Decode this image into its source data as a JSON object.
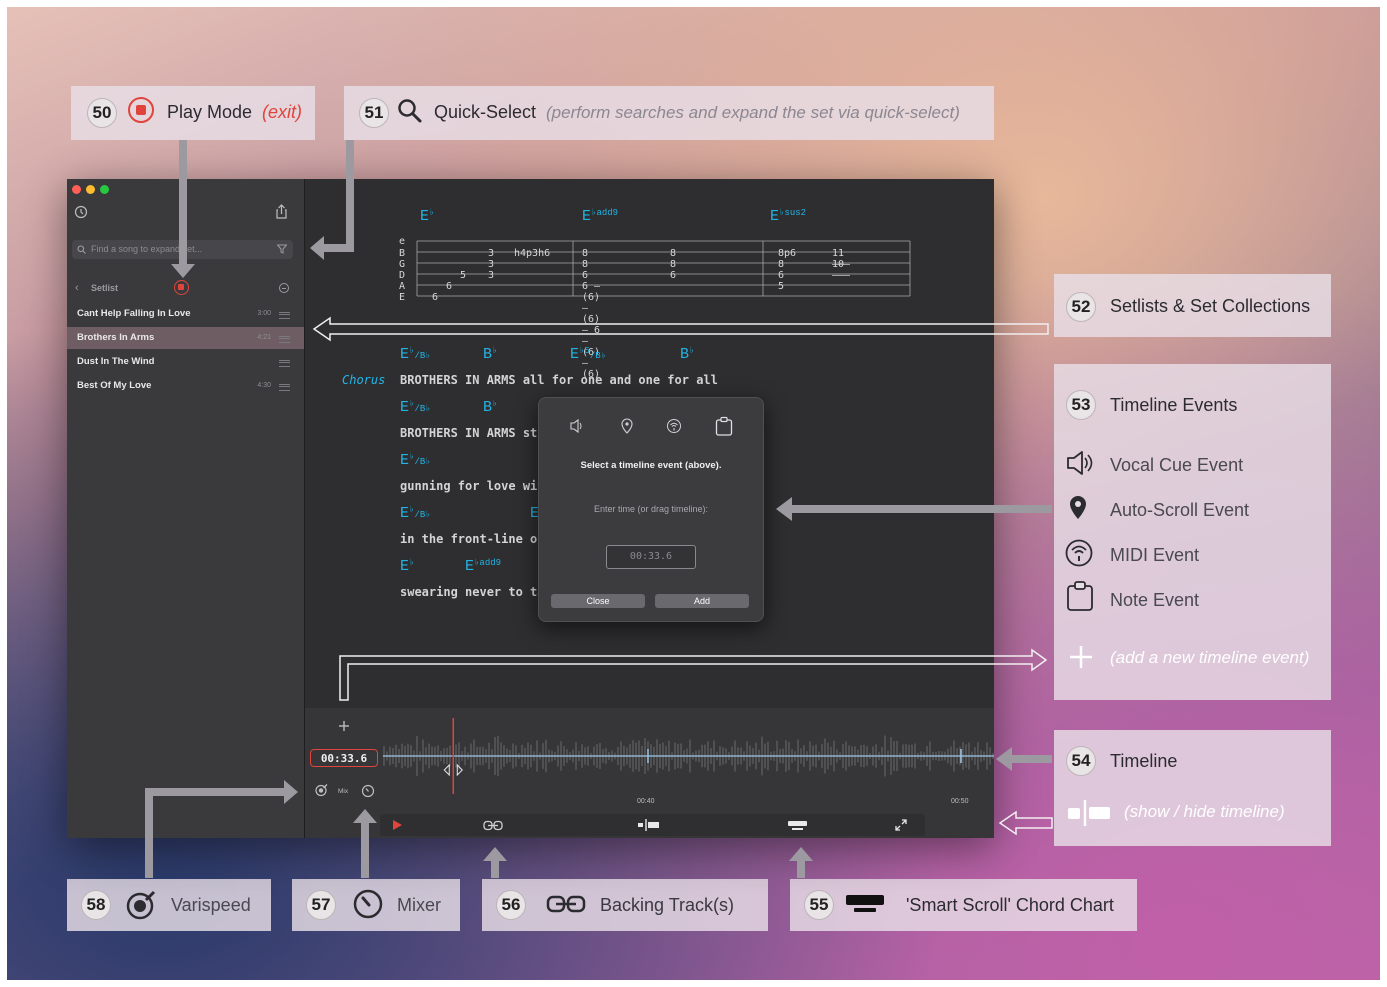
{
  "callouts": {
    "c50": {
      "num": "50",
      "label": "Play Mode",
      "note": "(exit)"
    },
    "c51": {
      "num": "51",
      "label": "Quick-Select",
      "note": "(perform searches and expand the set via quick-select)"
    },
    "c52": {
      "num": "52",
      "label": "Setlists & Set Collections"
    },
    "c53": {
      "num": "53",
      "label": "Timeline Events",
      "items": [
        "Vocal Cue Event",
        "Auto-Scroll Event",
        "MIDI Event",
        "Note Event"
      ],
      "add_note": "(add a new timeline event)"
    },
    "c54": {
      "num": "54",
      "label": "Timeline",
      "note": "(show / hide timeline)"
    },
    "c55": {
      "num": "55",
      "label": "'Smart Scroll' Chord Chart"
    },
    "c56": {
      "num": "56",
      "label": "Backing Track(s)"
    },
    "c57": {
      "num": "57",
      "label": "Mixer"
    },
    "c58": {
      "num": "58",
      "label": "Varispeed"
    }
  },
  "sidebar": {
    "search_placeholder": "Find a song to expand set...",
    "setlist_label": "Setlist",
    "songs": [
      {
        "title": "Cant Help Falling In Love",
        "duration": "3:00"
      },
      {
        "title": "Brothers In Arms",
        "duration": "4:21"
      },
      {
        "title": "Dust In The Wind",
        "duration": ""
      },
      {
        "title": "Best Of My Love",
        "duration": "4:30"
      }
    ]
  },
  "tab": {
    "chords": [
      {
        "root": "E",
        "acc": "♭",
        "ext": ""
      },
      {
        "root": "E",
        "acc": "♭",
        "ext": "add9"
      },
      {
        "root": "E",
        "acc": "♭",
        "ext": "sus2"
      }
    ],
    "strings": [
      "e",
      "B",
      "G",
      "D",
      "A",
      "E"
    ]
  },
  "sheet": {
    "section_label": "Chorus",
    "lines": [
      {
        "lyric": "BROTHERS IN ARMS all for one and one for all"
      },
      {
        "lyric": "BROTHERS IN ARMS st"
      },
      {
        "lyric": "gunning for love with"
      },
      {
        "lyric": "in the front-line of b"
      },
      {
        "lyric": "swearing never to ta"
      }
    ]
  },
  "modal": {
    "instruction": "Select a timeline event (above).",
    "time_label": "Enter time (or drag timeline):",
    "time_value": "00:33.6",
    "close_label": "Close",
    "add_label": "Add"
  },
  "timeline": {
    "current_time": "00:33.6",
    "mix_label": "Mix",
    "mark_1": "00:40",
    "mark_2": "00:50",
    "playhead_fraction": 0.115
  },
  "colors": {
    "accent_chord": "#22b4e6",
    "record_red": "#e1443c",
    "playhead": "#e1443c"
  }
}
